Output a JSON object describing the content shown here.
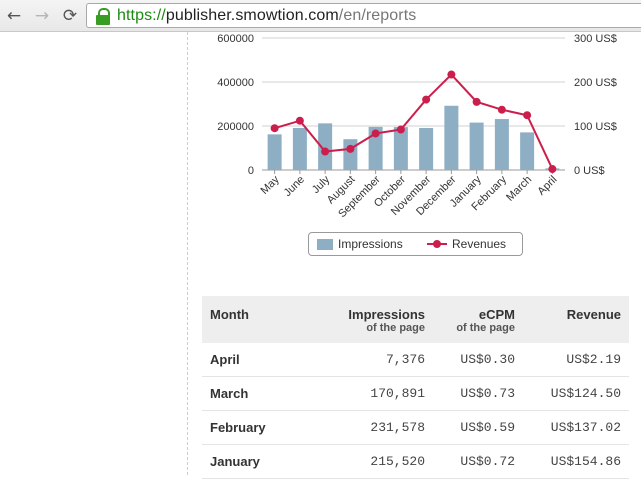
{
  "browser": {
    "url_scheme": "https://",
    "url_host": "publisher.smowtion.com",
    "url_path": "/en/reports",
    "back_icon": "←",
    "forward_icon": "→",
    "reload_icon": "⟳"
  },
  "chart_data": {
    "type": "bar",
    "categories": [
      "May",
      "June",
      "July",
      "August",
      "September",
      "October",
      "November",
      "December",
      "January",
      "February",
      "March",
      "April"
    ],
    "series": [
      {
        "name": "Impressions",
        "type": "bar",
        "axis": "left",
        "color": "#8eaec4",
        "values": [
          162000,
          191000,
          212000,
          140000,
          196000,
          195000,
          191000,
          292000,
          215520,
          231578,
          170891,
          7376
        ]
      },
      {
        "name": "Revenues",
        "type": "line",
        "axis": "right",
        "color": "#cc1e4c",
        "values": [
          95,
          112,
          42,
          48,
          83,
          92,
          160,
          217,
          154.86,
          137.02,
          124.5,
          2.19
        ]
      }
    ],
    "left_axis": {
      "ticks": [
        0,
        200000,
        400000,
        600000
      ],
      "tick_labels": [
        "0",
        "200000",
        "400000",
        "600000"
      ],
      "ylim": [
        0,
        600000
      ]
    },
    "right_axis": {
      "ticks": [
        0,
        100,
        200,
        300
      ],
      "tick_labels": [
        "0 US$",
        "100 US$",
        "200 US$",
        "300 US$"
      ],
      "ylim": [
        0,
        300
      ]
    },
    "grid": true,
    "legend": {
      "placement": "bottom-center",
      "items": [
        "Impressions",
        "Revenues"
      ]
    }
  },
  "table": {
    "headers": [
      {
        "label": "Month",
        "sub": ""
      },
      {
        "label": "Impressions",
        "sub": "of the page"
      },
      {
        "label": "eCPM",
        "sub": "of the page"
      },
      {
        "label": "Revenue",
        "sub": ""
      }
    ],
    "rows": [
      {
        "month": "April",
        "impressions": "7,376",
        "ecpm": "US$0.30",
        "revenue": "US$2.19"
      },
      {
        "month": "March",
        "impressions": "170,891",
        "ecpm": "US$0.73",
        "revenue": "US$124.50"
      },
      {
        "month": "February",
        "impressions": "231,578",
        "ecpm": "US$0.59",
        "revenue": "US$137.02"
      },
      {
        "month": "January",
        "impressions": "215,520",
        "ecpm": "US$0.72",
        "revenue": "US$154.86"
      }
    ]
  }
}
